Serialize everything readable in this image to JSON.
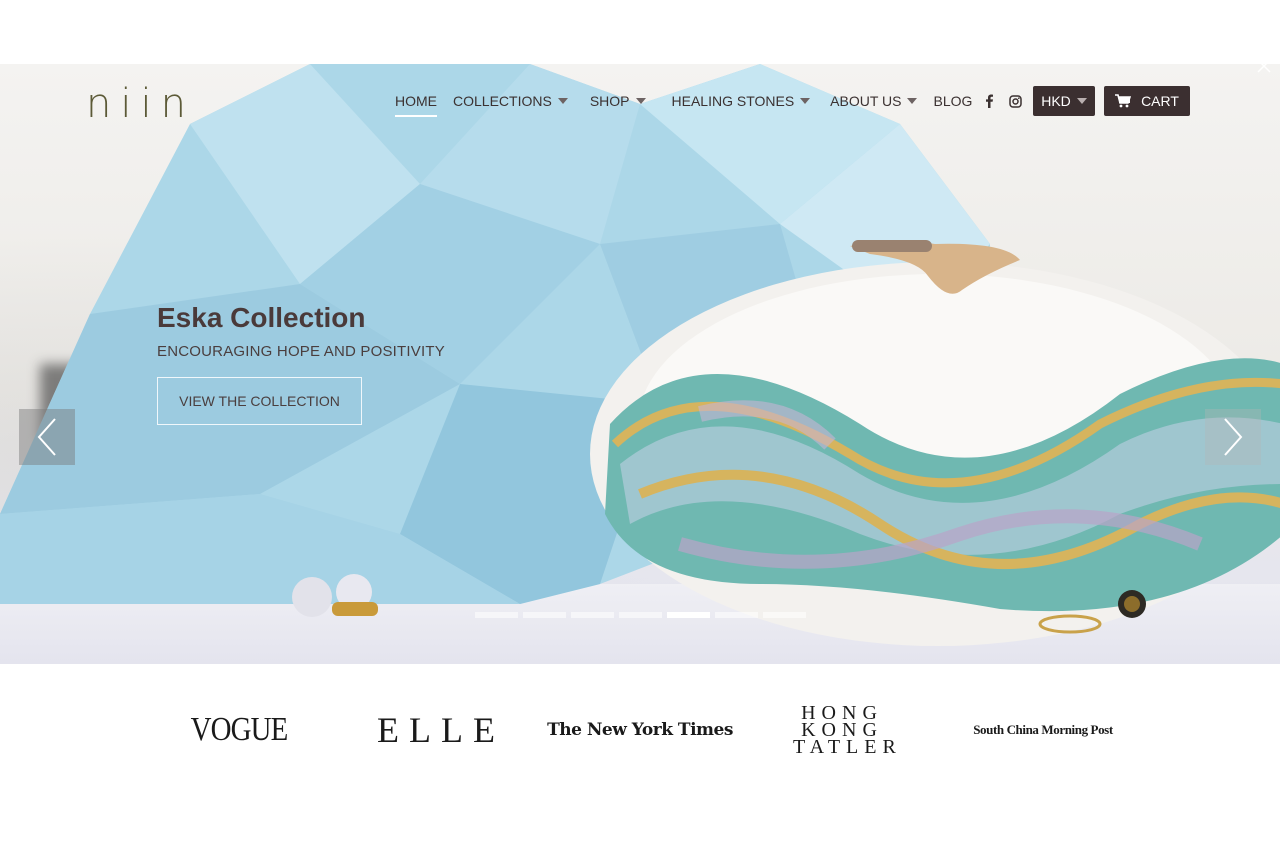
{
  "brand": {
    "logo_text": "niin"
  },
  "nav": {
    "items": [
      {
        "label": "HOME",
        "active": true,
        "dropdown": false
      },
      {
        "label": "COLLECTIONS",
        "active": false,
        "dropdown": true
      },
      {
        "label": "SHOP",
        "active": false,
        "dropdown": true
      },
      {
        "label": "HEALING STONES",
        "active": false,
        "dropdown": true
      },
      {
        "label": "ABOUT US",
        "active": false,
        "dropdown": true
      },
      {
        "label": "BLOG",
        "active": false,
        "dropdown": false
      }
    ],
    "social_icons": [
      "facebook-icon",
      "instagram-icon",
      "mail-icon",
      "search-icon"
    ],
    "currency": "HKD",
    "cart_label": "CART"
  },
  "hero": {
    "title": "Eska Collection",
    "subtitle": "ENCOURAGING HOPE AND POSITIVITY",
    "cta_label": "VIEW THE COLLECTION",
    "slide_count": 7,
    "active_slide": 5
  },
  "press": {
    "logos": [
      "VOGUE",
      "ELLE",
      "The New York Times",
      "HONG KONG TATLER",
      "South China Morning Post"
    ]
  },
  "colors": {
    "accent_dark": "#3b2f30",
    "logo": "#5c5a37",
    "crystal": "#a9d4e6"
  }
}
